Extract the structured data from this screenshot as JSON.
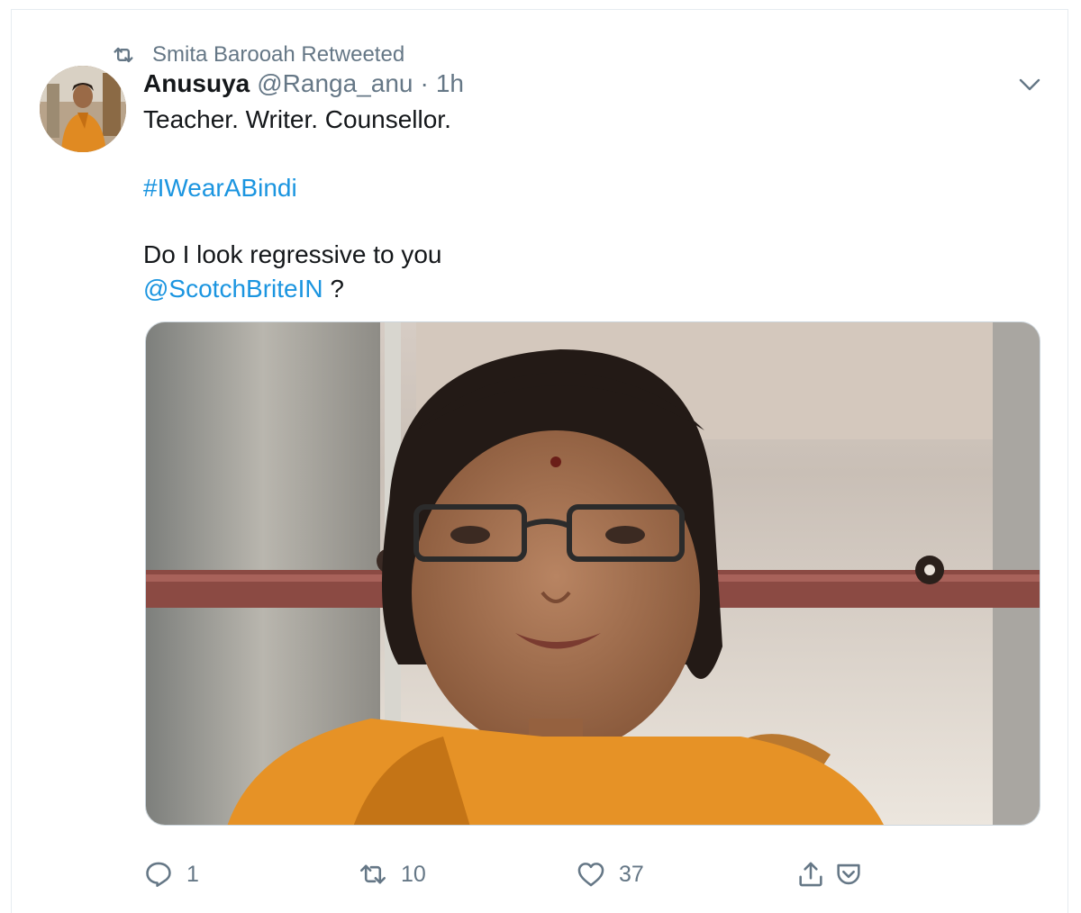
{
  "retweet": {
    "text": "Smita Barooah Retweeted",
    "icon": "retweet-icon"
  },
  "tweet": {
    "author_name": "Anusuya",
    "handle": "@Ranga_anu",
    "separator": "·",
    "time": "1h",
    "lines": {
      "line1": "Teacher. Writer. Counsellor.",
      "hashtag": "#IWearABindi",
      "line3": "Do I look regressive to you",
      "mention": "@ScotchBriteIN",
      "question": " ?"
    }
  },
  "actions": {
    "reply_count": "1",
    "retweet_count": "10",
    "like_count": "37"
  },
  "colors": {
    "link": "#1b95e0",
    "muted": "#657786",
    "text": "#14171a",
    "border": "#e6ecf0"
  }
}
